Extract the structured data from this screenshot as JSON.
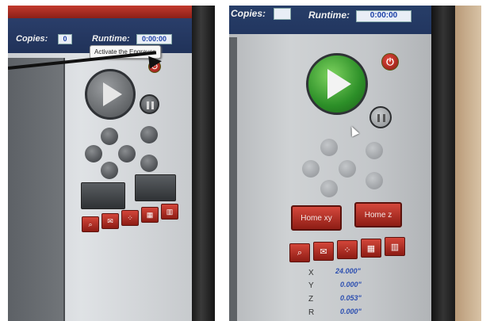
{
  "left_photo": {
    "copies_label": "Copies:",
    "copies_value": "0",
    "runtime_label": "Runtime:",
    "runtime_value": "0:00:00",
    "tooltip": "Activate the Engraver.",
    "tool_icons": [
      "zoom-icon",
      "envelope-icon",
      "dots-icon",
      "pattern-icon",
      "ruler-icon"
    ]
  },
  "right_photo": {
    "copies_label": "Copies:",
    "runtime_label": "Runtime:",
    "runtime_value": "0:00:00",
    "home_xy": "Home xy",
    "home_z": "Home z",
    "coords": [
      {
        "axis": "X",
        "value": "24.000\""
      },
      {
        "axis": "Y",
        "value": "0.000\""
      },
      {
        "axis": "Z",
        "value": "0.053\""
      },
      {
        "axis": "R",
        "value": "0.000\""
      }
    ]
  },
  "colors": {
    "accent_red": "#c23a2e",
    "play_green": "#3aa536",
    "readout_blue": "#2d4fb0"
  }
}
